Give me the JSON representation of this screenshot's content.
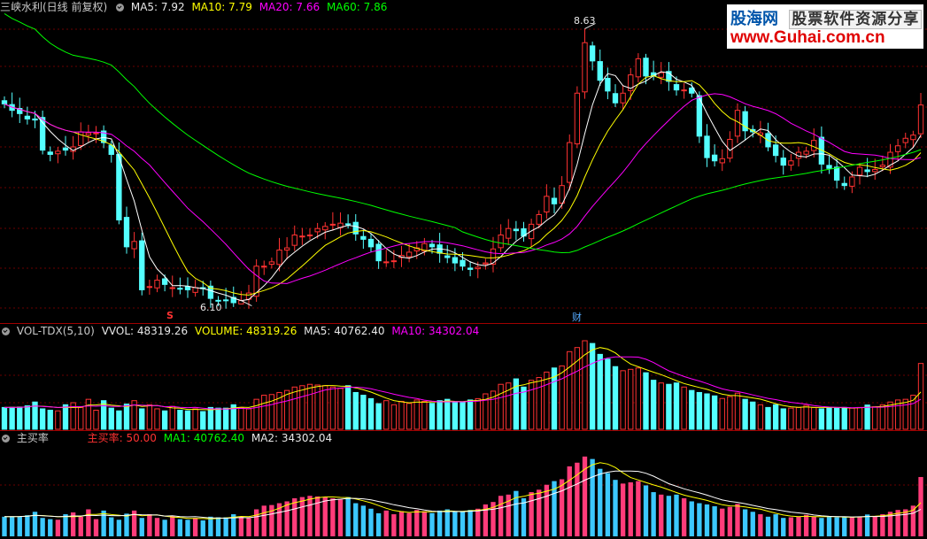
{
  "main_panel": {
    "stock_name": "三峡水利(日线 前复权)",
    "ma5": "MA5: 7.92",
    "ma10": "MA10: 7.79",
    "ma20": "MA20: 7.66",
    "ma60": "MA60: 7.86",
    "high_label": "8.63",
    "low_label": "6.10",
    "marker_s": "S",
    "marker_cai": "财"
  },
  "volume_panel": {
    "title": "VOL-TDX(5,10)",
    "vvol": "VVOL: 48319.26",
    "volume": "VOLUME: 48319.26",
    "ma5": "MA5: 40762.40",
    "ma10": "MA10: 34302.04"
  },
  "buy_panel": {
    "title": "主买率",
    "ratio": "主买率: 50.00",
    "ma1": "MA1: 40762.40",
    "ma2": "MA2: 34302.04"
  },
  "watermark": {
    "name": "股海网",
    "slogan": "股票软件资源分享",
    "url": "www.Guhai.com.cn"
  },
  "colors": {
    "up": "#ff3232",
    "down": "#54ffff",
    "ma5": "#ffffff",
    "ma10": "#ffff00",
    "ma20": "#ff00ff",
    "ma60": "#00ff00",
    "buy_up": "#ff3c7a",
    "buy_down": "#3cc8ff"
  },
  "chart_data": {
    "type": "candlestick",
    "price_range": [
      6.1,
      8.63
    ],
    "close": [
      7.93,
      7.87,
      7.84,
      7.79,
      7.78,
      7.5,
      7.46,
      7.49,
      7.5,
      7.53,
      7.67,
      7.66,
      7.66,
      7.57,
      7.46,
      6.85,
      6.6,
      6.65,
      6.2,
      6.23,
      6.29,
      6.25,
      6.22,
      6.21,
      6.2,
      6.22,
      6.21,
      6.12,
      6.1,
      6.1,
      6.08,
      6.1,
      6.17,
      6.42,
      6.42,
      6.46,
      6.57,
      6.59,
      6.71,
      6.7,
      6.71,
      6.77,
      6.79,
      6.81,
      6.82,
      6.81,
      6.72,
      6.67,
      6.6,
      6.47,
      6.46,
      6.47,
      6.52,
      6.55,
      6.59,
      6.63,
      6.6,
      6.54,
      6.5,
      6.45,
      6.42,
      6.39,
      6.41,
      6.45,
      6.58,
      6.71,
      6.77,
      6.75,
      6.7,
      6.81,
      6.9,
      7.07,
      7.0,
      7.17,
      7.57,
      8.03,
      8.5,
      8.33,
      8.15,
      8.05,
      7.94,
      8.03,
      8.2,
      8.35,
      8.19,
      8.19,
      8.22,
      8.14,
      8.06,
      8.06,
      8.03,
      7.63,
      7.43,
      7.4,
      7.42,
      7.6,
      7.87,
      7.68,
      7.67,
      7.66,
      7.53,
      7.45,
      7.36,
      7.4,
      7.48,
      7.49,
      7.59,
      7.37,
      7.33,
      7.22,
      7.17,
      7.25,
      7.34,
      7.3,
      7.32,
      7.36,
      7.48,
      7.54,
      7.61,
      7.64,
      7.92
    ],
    "volume": [
      16000,
      16100,
      16300,
      17200,
      20000,
      15000,
      14000,
      13500,
      18000,
      19500,
      16000,
      22000,
      14000,
      21000,
      15500,
      13500,
      18500,
      21000,
      15000,
      18000,
      15000,
      13500,
      16800,
      14000,
      13500,
      15000,
      13000,
      16000,
      15500,
      15500,
      18000,
      16000,
      15000,
      22000,
      25000,
      25500,
      27000,
      28500,
      31000,
      32000,
      33000,
      32500,
      32000,
      31000,
      30000,
      32000,
      27000,
      25000,
      22500,
      18800,
      21000,
      18000,
      20500,
      19000,
      21500,
      20500,
      19000,
      21000,
      22000,
      19800,
      20000,
      21500,
      22500,
      26000,
      28000,
      33000,
      34000,
      37000,
      31000,
      36000,
      38000,
      42000,
      45000,
      46500,
      57000,
      60000,
      65000,
      63000,
      55000,
      51500,
      46000,
      43000,
      44000,
      45000,
      41500,
      36000,
      34000,
      33000,
      34000,
      31000,
      28500,
      27000,
      26000,
      24500,
      22600,
      24000,
      26500,
      22000,
      20000,
      18000,
      16000,
      18000,
      15000,
      15500,
      16000,
      17500,
      16000,
      15000,
      16000,
      15500,
      16000,
      15500,
      16000,
      17800,
      16500,
      18000,
      20000,
      21500,
      22000,
      25000,
      48319.26
    ]
  }
}
